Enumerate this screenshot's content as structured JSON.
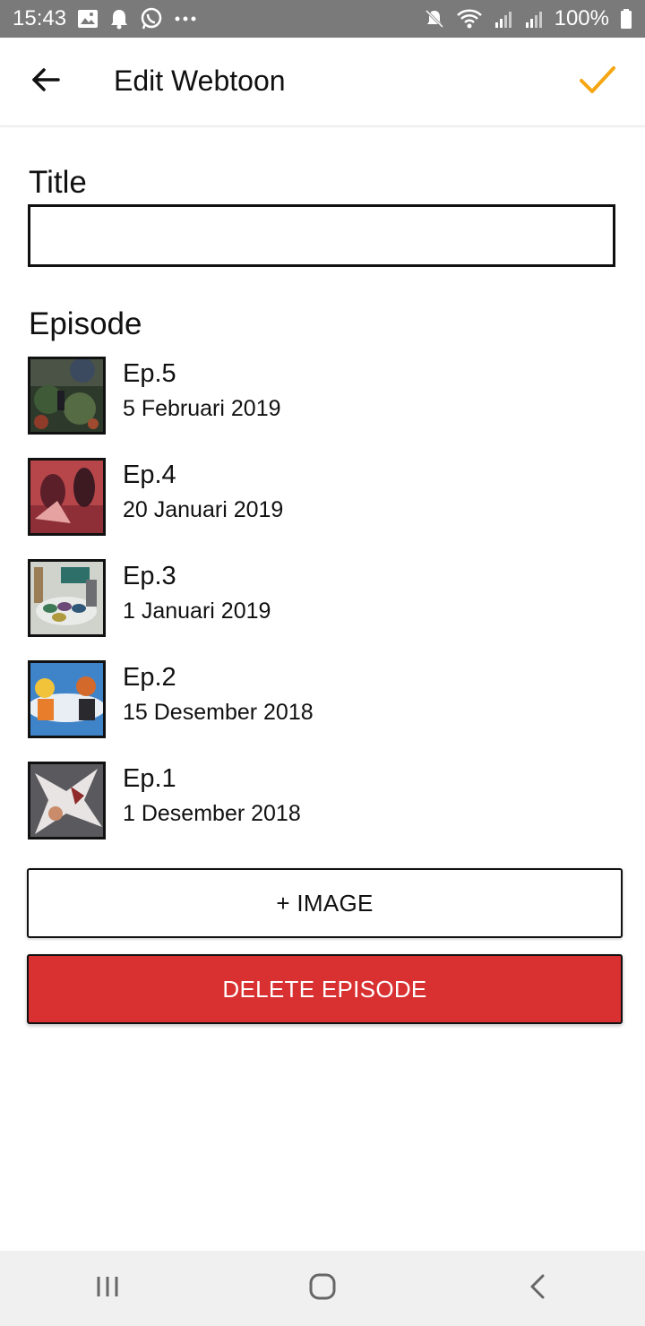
{
  "status_bar": {
    "time": "15:43",
    "left_icons": [
      "gallery-icon",
      "bell-icon",
      "whatsapp-icon",
      "more-dots-icon"
    ],
    "right_icons": [
      "mute-icon",
      "wifi-icon",
      "signal-icon",
      "signal-icon",
      "battery-icon"
    ],
    "battery": "100%"
  },
  "app_bar": {
    "title": "Edit Webtoon",
    "back_icon": "arrow-left-icon",
    "confirm_icon": "check-icon",
    "accent_color": "#f5a612"
  },
  "form": {
    "title_label": "Title",
    "title_value": "",
    "episode_label": "Episode"
  },
  "episodes": [
    {
      "title": "Ep.5",
      "date": "5 Februari 2019"
    },
    {
      "title": "Ep.4",
      "date": "20 Januari 2019"
    },
    {
      "title": "Ep.3",
      "date": "1 Januari 2019"
    },
    {
      "title": "Ep.2",
      "date": "15 Desember 2018"
    },
    {
      "title": "Ep.1",
      "date": "1 Desember 2018"
    }
  ],
  "buttons": {
    "add_image": "+ IMAGE",
    "delete_episode": "DELETE EPISODE",
    "delete_color": "#d93031"
  },
  "nav_bar": {
    "icons": [
      "recent-apps-icon",
      "home-icon",
      "back-icon"
    ]
  }
}
